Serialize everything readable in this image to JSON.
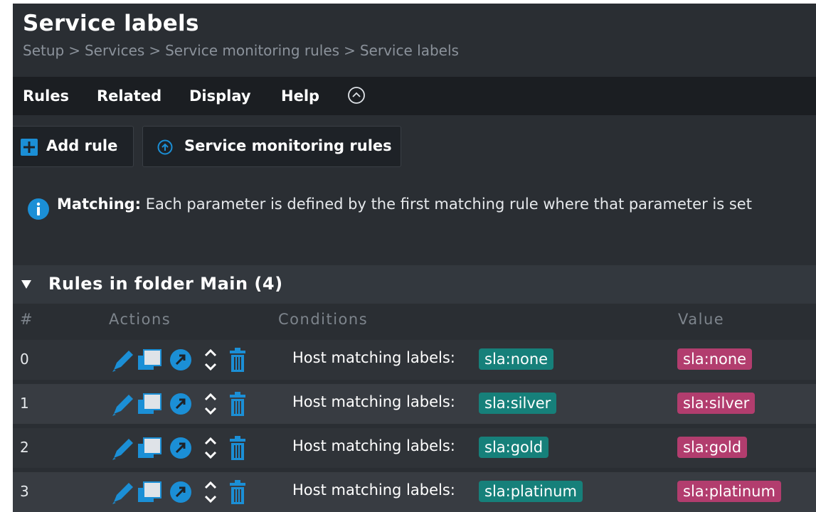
{
  "header": {
    "title": "Service labels",
    "breadcrumb": [
      "Setup",
      "Services",
      "Service monitoring rules",
      "Service labels"
    ],
    "breadcrumb_sep": ">"
  },
  "menu": {
    "items": [
      "Rules",
      "Related",
      "Display",
      "Help"
    ],
    "toggle_icon": "chevron-up-circle-icon"
  },
  "shortcuts": {
    "add_rule_label": "Add rule",
    "service_monitoring_rules_label": "Service monitoring rules"
  },
  "info": {
    "bold": "Matching:",
    "text": " Each parameter is defined by the first matching rule where that parameter is set"
  },
  "rules_section": {
    "title": "Rules in folder Main (4)",
    "columns": {
      "num": "#",
      "actions": "Actions",
      "conditions": "Conditions",
      "value": "Value"
    },
    "rows": [
      {
        "num": "0",
        "condition_label": "Host matching labels:",
        "condition_chip": "sla:none",
        "value_chip": "sla:none"
      },
      {
        "num": "1",
        "condition_label": "Host matching labels:",
        "condition_chip": "sla:silver",
        "value_chip": "sla:silver"
      },
      {
        "num": "2",
        "condition_label": "Host matching labels:",
        "condition_chip": "sla:gold",
        "value_chip": "sla:gold"
      },
      {
        "num": "3",
        "condition_label": "Host matching labels:",
        "condition_chip": "sla:platinum",
        "value_chip": "sla:platinum"
      }
    ]
  },
  "colors": {
    "label_chip": "#16807a",
    "value_chip": "#b23d6e",
    "icon_blue": "#1b8fd6",
    "add_icon": "#1b8fd6"
  }
}
